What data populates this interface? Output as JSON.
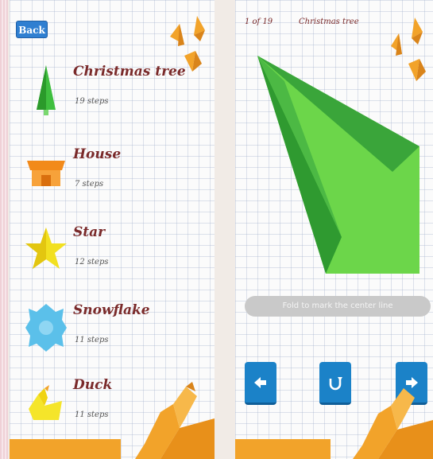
{
  "list_screen": {
    "back_label": "Back",
    "models": [
      {
        "name": "Christmas tree",
        "steps": "19 steps",
        "icon": "christmas-tree-icon"
      },
      {
        "name": "House",
        "steps": "7 steps",
        "icon": "house-icon"
      },
      {
        "name": "Star",
        "steps": "12 steps",
        "icon": "star-icon"
      },
      {
        "name": "Snowflake",
        "steps": "11 steps",
        "icon": "snowflake-icon"
      },
      {
        "name": "Duck",
        "steps": "11 steps",
        "icon": "duck-icon"
      }
    ]
  },
  "step_screen": {
    "step_counter": "1 of 19",
    "model_title": "Christmas tree",
    "instruction": "Fold to mark the center line",
    "buttons": {
      "prev": "left-arrow-icon",
      "reset": "restart-icon",
      "next": "right-arrow-icon"
    }
  },
  "colors": {
    "accent_blue": "#1b82c8",
    "title_brown": "#7a2a2a",
    "paper_green": "#6cd64a",
    "paper_dark_green": "#3aa53a",
    "origami_orange": "#f2a32a"
  }
}
